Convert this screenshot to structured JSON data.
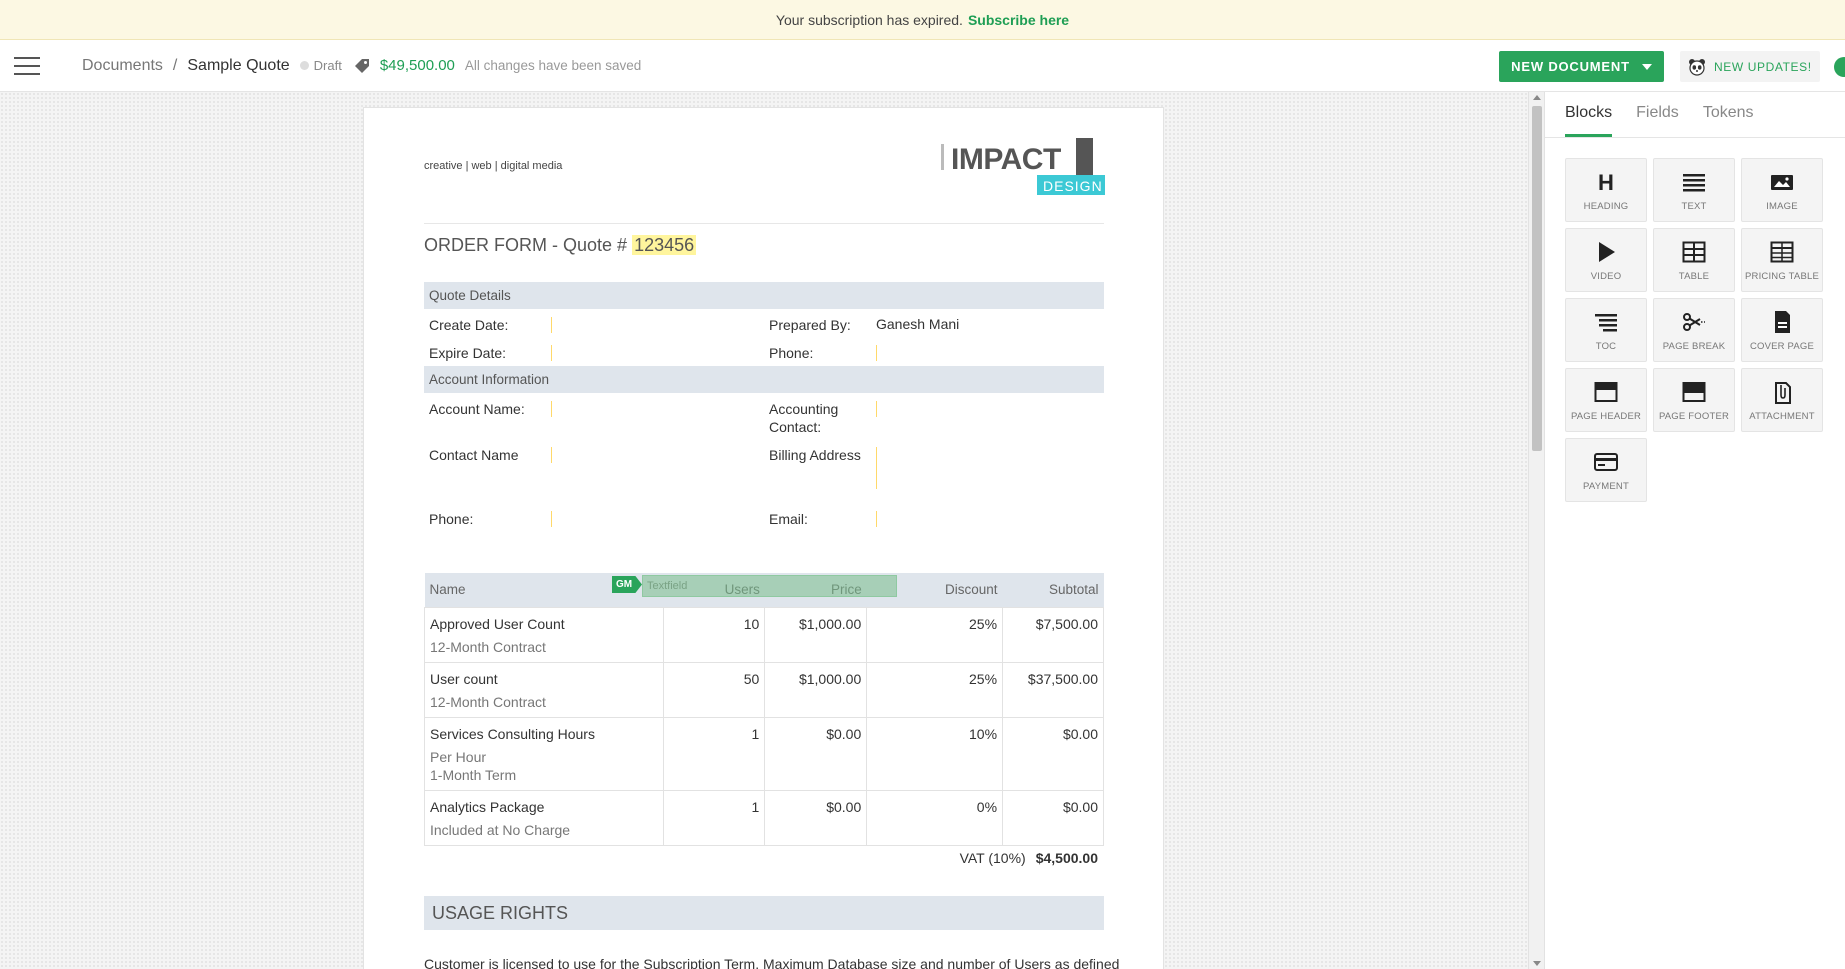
{
  "banner": {
    "text": "Your subscription has expired.",
    "link": "Subscribe here"
  },
  "header": {
    "breadcrumb_root": "Documents",
    "breadcrumb_sep": "/",
    "doc_title": "Sample Quote",
    "status": "Draft",
    "price": "$49,500.00",
    "save_status": "All changes have been saved",
    "new_document": "NEW DOCUMENT",
    "new_updates": "NEW UPDATES!"
  },
  "doc": {
    "tagline": "creative | web | digital media",
    "logo_main": "IMPACT",
    "logo_sub": "DESIGN",
    "title_prefix": "ORDER FORM - Quote #",
    "quote_number": "123456",
    "quote_details": "Quote Details",
    "create_date": "Create Date:",
    "expire_date": "Expire Date:",
    "prepared_by": "Prepared By:",
    "prepared_by_value": "Ganesh Mani",
    "phone": "Phone:",
    "account_information": "Account Information",
    "account_name": "Account Name:",
    "accounting_contact": "Accounting Contact:",
    "contact_name": "Contact Name",
    "billing_address": "Billing Address",
    "phone2": "Phone:",
    "email": "Email:",
    "gm_badge": "GM",
    "textfield_label": "Textfield",
    "table_headers": [
      "Name",
      "Users",
      "Price",
      "Discount",
      "Subtotal"
    ],
    "rows": [
      {
        "name": "Approved User Count",
        "sub": "12-Month Contract",
        "sub2": "",
        "users": "10",
        "price": "$1,000.00",
        "discount": "25%",
        "subtotal": "$7,500.00"
      },
      {
        "name": "User count",
        "sub": "12-Month Contract",
        "sub2": "",
        "users": "50",
        "price": "$1,000.00",
        "discount": "25%",
        "subtotal": "$37,500.00"
      },
      {
        "name": "Services Consulting Hours",
        "sub": "Per Hour",
        "sub2": "1-Month Term",
        "users": "1",
        "price": "$0.00",
        "discount": "10%",
        "subtotal": "$0.00"
      },
      {
        "name": "Analytics Package",
        "sub": "Included at No Charge",
        "sub2": "",
        "users": "1",
        "price": "$0.00",
        "discount": "0%",
        "subtotal": "$0.00"
      }
    ],
    "vat_label": "VAT (10%)",
    "vat_value": "$4,500.00",
    "usage_rights": "USAGE RIGHTS",
    "usage_text": "Customer is licensed to use  for the Subscription Term. Maximum Database size and number of Users as defined"
  },
  "panel": {
    "tabs": [
      "Blocks",
      "Fields",
      "Tokens"
    ],
    "blocks": [
      {
        "label": "HEADING",
        "icon": "heading-icon"
      },
      {
        "label": "TEXT",
        "icon": "text-icon"
      },
      {
        "label": "IMAGE",
        "icon": "image-icon"
      },
      {
        "label": "VIDEO",
        "icon": "video-icon"
      },
      {
        "label": "TABLE",
        "icon": "table-icon"
      },
      {
        "label": "PRICING TABLE",
        "icon": "pricing-table-icon"
      },
      {
        "label": "TOC",
        "icon": "toc-icon"
      },
      {
        "label": "PAGE BREAK",
        "icon": "scissors-icon"
      },
      {
        "label": "COVER PAGE",
        "icon": "cover-page-icon"
      },
      {
        "label": "PAGE HEADER",
        "icon": "page-header-icon"
      },
      {
        "label": "PAGE FOOTER",
        "icon": "page-footer-icon"
      },
      {
        "label": "ATTACHMENT",
        "icon": "attachment-icon"
      },
      {
        "label": "PAYMENT",
        "icon": "payment-icon"
      }
    ]
  },
  "colors": {
    "accent": "#2aa45b",
    "banner_bg": "#fcf8e3",
    "section_bg": "#dfe5ec",
    "highlight": "#fff59d"
  }
}
